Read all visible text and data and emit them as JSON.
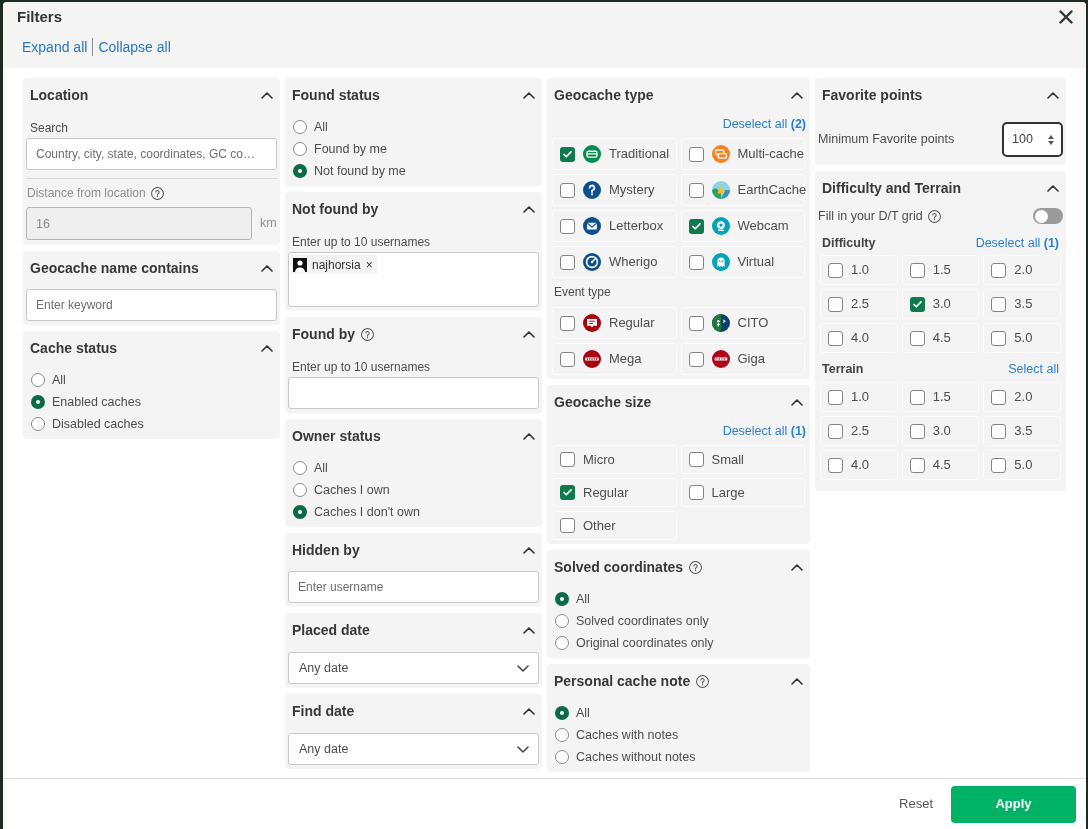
{
  "dialog": {
    "title": "Filters",
    "links": [
      "Expand all",
      "Collapse all"
    ]
  },
  "columns": [
    {
      "sections": [
        {
          "kind": "location",
          "title": "Location",
          "expanded": true,
          "search": {
            "label": "Search",
            "placeholder": "Country, city, state, coordinates, GC co…"
          },
          "distance": {
            "label": "Distance from location",
            "help": true,
            "value": "16",
            "unit": "km",
            "disabled": true
          }
        },
        {
          "kind": "text",
          "title": "Geocache name contains",
          "expanded": true,
          "input": {
            "placeholder": "Enter keyword"
          }
        },
        {
          "kind": "radio",
          "title": "Cache status",
          "expanded": true,
          "options": [
            {
              "label": "All",
              "selected": false
            },
            {
              "label": "Enabled caches",
              "selected": true
            },
            {
              "label": "Disabled caches",
              "selected": false
            }
          ]
        }
      ]
    },
    {
      "sections": [
        {
          "kind": "radio",
          "title": "Found status",
          "expanded": true,
          "options": [
            {
              "label": "All",
              "selected": false
            },
            {
              "label": "Found by me",
              "selected": false
            },
            {
              "label": "Not found by me",
              "selected": true
            }
          ]
        },
        {
          "kind": "users",
          "title": "Not found by",
          "expanded": true,
          "hint": "Enter up to 10 usernames",
          "tags": [
            {
              "label": "najhorsia",
              "remove": "×"
            }
          ]
        },
        {
          "kind": "users",
          "title": "Found by",
          "help": true,
          "expanded": true,
          "hint": "Enter up to 10 usernames"
        },
        {
          "kind": "radio",
          "title": "Owner status",
          "expanded": true,
          "options": [
            {
              "label": "All",
              "selected": false
            },
            {
              "label": "Caches I own",
              "selected": false
            },
            {
              "label": "Caches I don't own",
              "selected": true
            }
          ]
        },
        {
          "kind": "text",
          "title": "Hidden by",
          "expanded": true,
          "input": {
            "placeholder": "Enter username"
          }
        },
        {
          "kind": "select",
          "title": "Placed date",
          "expanded": true,
          "select": {
            "value": "Any date"
          }
        },
        {
          "kind": "select",
          "title": "Find date",
          "expanded": true,
          "select": {
            "value": "Any date"
          }
        }
      ]
    },
    {
      "sections": [
        {
          "kind": "checkboxes",
          "title": "Geocache type",
          "expanded": true,
          "action": "Deselect all **(2)**",
          "groups": [
            {
              "items": [
                {
                  "label": "Traditional",
                  "kind": "traditional",
                  "checked": true
                },
                {
                  "label": "Multi-cache",
                  "kind": "multi",
                  "checked": false
                },
                {
                  "label": "Mystery",
                  "kind": "mystery",
                  "checked": false
                },
                {
                  "label": "EarthCache",
                  "kind": "earth",
                  "checked": false
                },
                {
                  "label": "Letterbox",
                  "kind": "letterbox",
                  "checked": false
                },
                {
                  "label": "Webcam",
                  "kind": "webcam",
                  "checked": true
                },
                {
                  "label": "Wherigo",
                  "kind": "wherigo",
                  "checked": false
                },
                {
                  "label": "Virtual",
                  "kind": "virtual",
                  "checked": false
                }
              ]
            },
            {
              "label": "Event type",
              "items": [
                {
                  "label": "Regular",
                  "kind": "event",
                  "checked": false
                },
                {
                  "label": "CITO",
                  "kind": "cito",
                  "checked": false
                },
                {
                  "label": "Mega",
                  "kind": "mega",
                  "checked": false
                },
                {
                  "label": "Giga",
                  "kind": "giga",
                  "checked": false
                }
              ]
            }
          ]
        },
        {
          "kind": "checkboxes",
          "title": "Geocache size",
          "expanded": true,
          "action": "Deselect all **(1)**",
          "groups": [
            {
              "items": [
                {
                  "label": "Micro",
                  "checked": false
                },
                {
                  "label": "Small",
                  "checked": false
                },
                {
                  "label": "Regular",
                  "checked": true
                },
                {
                  "label": "Large",
                  "checked": false
                },
                {
                  "label": "Other",
                  "checked": false
                }
              ]
            }
          ]
        },
        {
          "kind": "radio",
          "title": "Solved coordinates",
          "help": true,
          "expanded": true,
          "options": [
            {
              "label": "All",
              "selected": true
            },
            {
              "label": "Solved coordinates only",
              "selected": false
            },
            {
              "label": "Original coordinates only",
              "selected": false
            }
          ]
        },
        {
          "kind": "radio",
          "title": "Personal cache note",
          "help": true,
          "expanded": true,
          "options": [
            {
              "label": "All",
              "selected": true
            },
            {
              "label": "Caches with notes",
              "selected": false
            },
            {
              "label": "Caches without notes",
              "selected": false
            }
          ]
        }
      ]
    },
    {
      "sections": [
        {
          "kind": "number",
          "title": "Favorite points",
          "expanded": true,
          "field": {
            "label": "Minimum Favorite points",
            "value": "100"
          }
        },
        {
          "kind": "grid",
          "title": "Difficulty and Terrain",
          "expanded": true,
          "toggle": {
            "label": "Fill in your D/T grid",
            "help": true,
            "on": false
          },
          "grids": [
            {
              "label": "Difficulty",
              "action": "Deselect all **(1)**",
              "items": [
                {
                  "label": "1.0",
                  "checked": false
                },
                {
                  "label": "1.5",
                  "checked": false
                },
                {
                  "label": "2.0",
                  "checked": false
                },
                {
                  "label": "2.5",
                  "checked": false
                },
                {
                  "label": "3.0",
                  "checked": true
                },
                {
                  "label": "3.5",
                  "checked": false
                },
                {
                  "label": "4.0",
                  "checked": false
                },
                {
                  "label": "4.5",
                  "checked": false
                },
                {
                  "label": "5.0",
                  "checked": false
                }
              ]
            },
            {
              "label": "Terrain",
              "action": "Select all",
              "items": [
                {
                  "label": "1.0",
                  "checked": false
                },
                {
                  "label": "1.5",
                  "checked": false
                },
                {
                  "label": "2.0",
                  "checked": false
                },
                {
                  "label": "2.5",
                  "checked": false
                },
                {
                  "label": "3.0",
                  "checked": false
                },
                {
                  "label": "3.5",
                  "checked": false
                },
                {
                  "label": "4.0",
                  "checked": false
                },
                {
                  "label": "4.5",
                  "checked": false
                },
                {
                  "label": "5.0",
                  "checked": false
                }
              ]
            }
          ]
        }
      ]
    }
  ],
  "footer": {
    "buttons": [
      {
        "label": "Reset",
        "kind": "secondary"
      },
      {
        "label": "Apply",
        "kind": "primary"
      }
    ]
  }
}
